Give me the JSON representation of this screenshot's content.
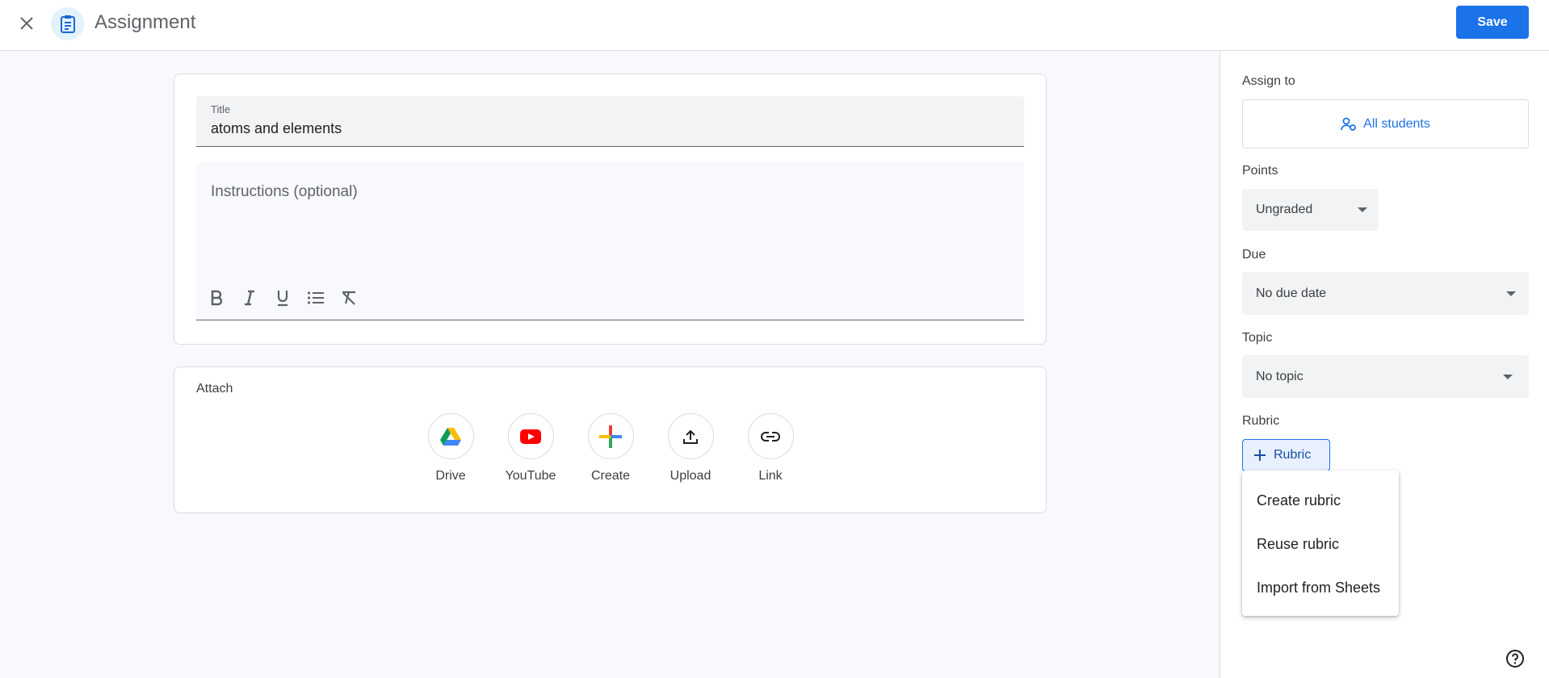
{
  "header": {
    "title": "Assignment",
    "save_label": "Save"
  },
  "form": {
    "title_label": "Title",
    "title_value": "atoms and elements",
    "instructions_placeholder": "Instructions (optional)",
    "formatting": [
      "bold-icon",
      "italic-icon",
      "underline-icon",
      "bulleted-list-icon",
      "clear-formatting-icon"
    ]
  },
  "attach": {
    "label": "Attach",
    "items": [
      {
        "label": "Drive",
        "icon": "drive-icon"
      },
      {
        "label": "YouTube",
        "icon": "youtube-icon"
      },
      {
        "label": "Create",
        "icon": "create-plus-icon"
      },
      {
        "label": "Upload",
        "icon": "upload-icon"
      },
      {
        "label": "Link",
        "icon": "link-icon"
      }
    ]
  },
  "sidebar": {
    "assign_to_label": "Assign to",
    "assign_to_value": "All students",
    "points_label": "Points",
    "points_value": "Ungraded",
    "due_label": "Due",
    "due_value": "No due date",
    "topic_label": "Topic",
    "topic_value": "No topic",
    "rubric_label": "Rubric",
    "rubric_button": "Rubric",
    "rubric_menu": [
      "Create rubric",
      "Reuse rubric",
      "Import from Sheets"
    ]
  },
  "colors": {
    "accent": "#1a73e8",
    "background": "#f8f9fd"
  }
}
